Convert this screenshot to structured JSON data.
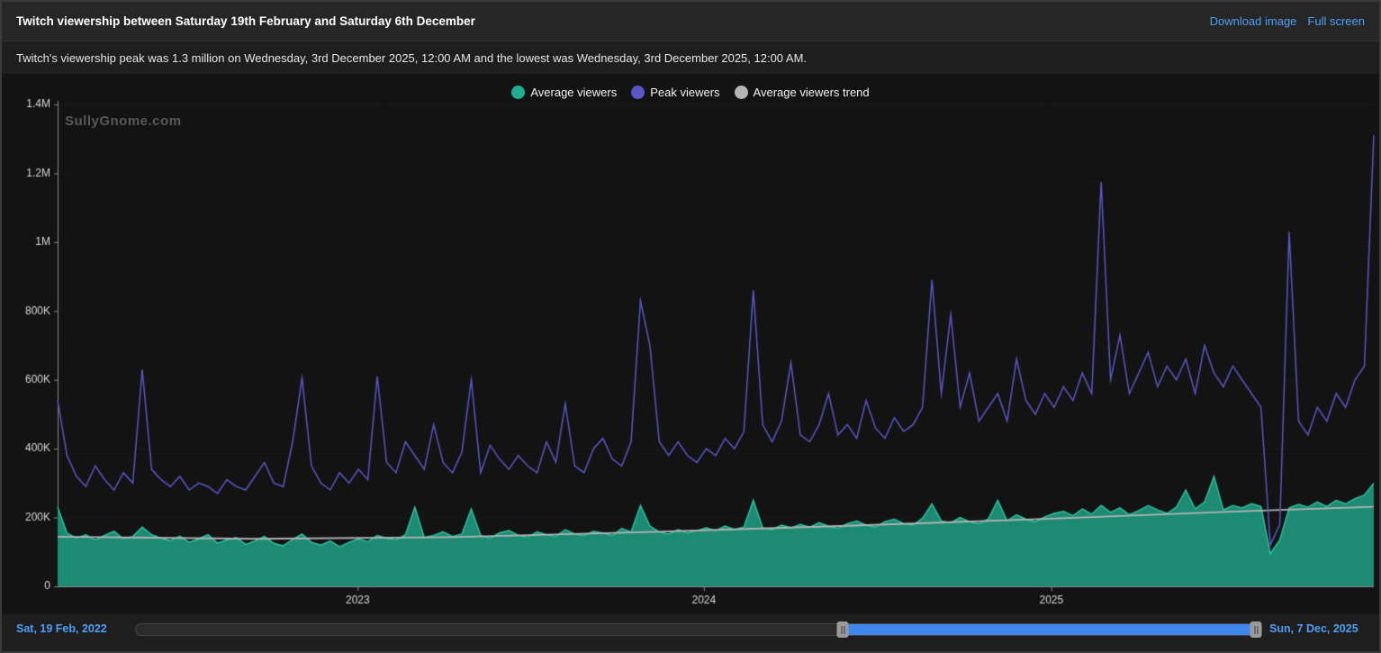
{
  "header": {
    "title": "Twitch viewership between Saturday 19th February and Saturday 6th December",
    "links": [
      {
        "label": "Download image"
      },
      {
        "label": "Full screen"
      }
    ]
  },
  "subtitle": "Twitch's viewership peak was 1.3 million on Wednesday, 3rd December 2025, 12:00 AM and the lowest was Wednesday, 3rd December 2025, 12:00 AM.",
  "watermark": "SullyGnome.com",
  "legend": [
    {
      "label": "Average viewers",
      "color": "#1fae93"
    },
    {
      "label": "Peak viewers",
      "color": "#5b57c8"
    },
    {
      "label": "Average viewers trend",
      "color": "#b5b5b5"
    }
  ],
  "slider": {
    "start_label": "Sat, 19 Feb, 2022",
    "end_label": "Sun, 7 Dec, 2025",
    "selected_start_frac": 0.627,
    "selected_end_frac": 0.994,
    "selected_color": "#3f86ec"
  },
  "chart_data": {
    "type": "area+line",
    "title": "Twitch viewership between Saturday 19th February and Saturday 6th December",
    "x_range_labels": [
      "Sat, 19 Feb, 2022",
      "Sun, 7 Dec, 2025"
    ],
    "x_ticks": [
      {
        "label": "2023",
        "t": 0.228
      },
      {
        "label": "2024",
        "t": 0.491
      },
      {
        "label": "2025",
        "t": 0.755
      }
    ],
    "y_ticks": [
      {
        "label": "0",
        "value": 0
      },
      {
        "label": "200K",
        "value": 200
      },
      {
        "label": "400K",
        "value": 400
      },
      {
        "label": "600K",
        "value": 600
      },
      {
        "label": "800K",
        "value": 800
      },
      {
        "label": "1M",
        "value": 1000
      },
      {
        "label": "1.2M",
        "value": 1200
      },
      {
        "label": "1.4M",
        "value": 1400
      }
    ],
    "y_max_thousands": 1400,
    "grid": false,
    "legend_position": "top-center",
    "series": [
      {
        "name": "Average viewers",
        "type": "area",
        "line_color": "#2ec7a3",
        "fill_color": "#1d8a73",
        "values_thousands": [
          230,
          155,
          140,
          150,
          135,
          148,
          160,
          138,
          145,
          172,
          150,
          140,
          133,
          146,
          128,
          138,
          150,
          126,
          135,
          142,
          122,
          132,
          145,
          125,
          118,
          136,
          152,
          128,
          120,
          132,
          115,
          128,
          138,
          130,
          148,
          140,
          135,
          150,
          230,
          142,
          148,
          158,
          145,
          152,
          225,
          148,
          140,
          155,
          162,
          148,
          143,
          158,
          150,
          145,
          165,
          152,
          148,
          160,
          155,
          148,
          168,
          158,
          235,
          175,
          158,
          152,
          165,
          155,
          162,
          170,
          162,
          175,
          165,
          172,
          250,
          170,
          165,
          178,
          170,
          180,
          172,
          185,
          175,
          168,
          182,
          190,
          178,
          172,
          188,
          195,
          182,
          178,
          198,
          240,
          190,
          185,
          200,
          188,
          182,
          196,
          250,
          190,
          208,
          195,
          188,
          202,
          212,
          218,
          205,
          225,
          210,
          235,
          215,
          228,
          208,
          220,
          235,
          222,
          212,
          230,
          280,
          225,
          245,
          320,
          222,
          235,
          228,
          240,
          232,
          95,
          135,
          228,
          238,
          230,
          245,
          232,
          250,
          240,
          255,
          265,
          300
        ]
      },
      {
        "name": "Peak viewers",
        "type": "line",
        "line_color": "#5b57c8",
        "values_thousands": [
          540,
          380,
          320,
          290,
          350,
          310,
          280,
          330,
          300,
          630,
          340,
          310,
          290,
          320,
          280,
          300,
          290,
          270,
          310,
          290,
          280,
          320,
          360,
          300,
          290,
          420,
          605,
          350,
          300,
          280,
          330,
          300,
          340,
          310,
          610,
          360,
          330,
          420,
          380,
          340,
          470,
          360,
          330,
          390,
          600,
          330,
          410,
          370,
          340,
          380,
          350,
          330,
          420,
          360,
          530,
          350,
          330,
          400,
          430,
          370,
          350,
          420,
          830,
          700,
          420,
          380,
          420,
          380,
          360,
          400,
          380,
          430,
          400,
          450,
          860,
          470,
          420,
          480,
          650,
          440,
          420,
          470,
          560,
          440,
          470,
          430,
          540,
          460,
          430,
          490,
          450,
          470,
          520,
          890,
          560,
          790,
          520,
          620,
          480,
          520,
          560,
          480,
          660,
          540,
          500,
          560,
          520,
          580,
          540,
          620,
          560,
          1175,
          600,
          730,
          560,
          620,
          680,
          580,
          640,
          600,
          660,
          560,
          700,
          620,
          580,
          640,
          600,
          560,
          520,
          120,
          180,
          1030,
          480,
          440,
          520,
          480,
          560,
          520,
          600,
          640,
          1310
        ]
      },
      {
        "name": "Average viewers trend",
        "type": "trend",
        "line_color": "#b5b5b5",
        "points": [
          [
            0,
            144
          ],
          [
            0.15,
            138
          ],
          [
            0.3,
            143
          ],
          [
            0.45,
            158
          ],
          [
            0.6,
            176
          ],
          [
            0.75,
            196
          ],
          [
            0.9,
            218
          ],
          [
            1,
            231
          ]
        ]
      }
    ]
  }
}
